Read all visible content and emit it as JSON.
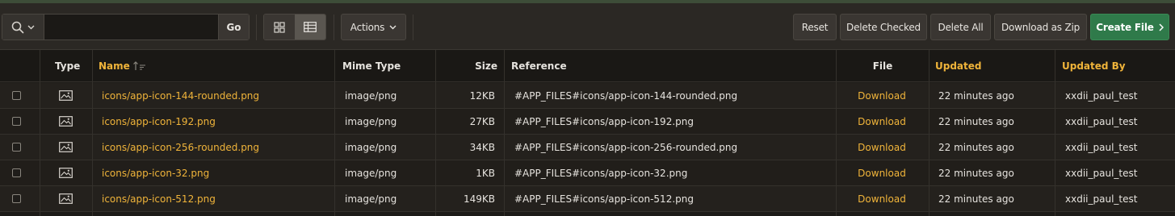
{
  "toolbar": {
    "search_placeholder": "",
    "search_value": "",
    "go_label": "Go",
    "actions_label": "Actions",
    "reset_label": "Reset",
    "delete_checked_label": "Delete Checked",
    "delete_all_label": "Delete All",
    "download_zip_label": "Download as Zip",
    "create_file_label": "Create File",
    "active_view": "report"
  },
  "table": {
    "columns": {
      "type": "Type",
      "name": "Name",
      "mime": "Mime Type",
      "size": "Size",
      "reference": "Reference",
      "file": "File",
      "updated": "Updated",
      "updated_by": "Updated By"
    },
    "sort": {
      "column": "name",
      "direction": "ascending"
    },
    "rows": [
      {
        "name": "icons/app-icon-144-rounded.png",
        "mime": "image/png",
        "size": "12KB",
        "reference": "#APP_FILES#icons/app-icon-144-rounded.png",
        "file": "Download",
        "updated": "22 minutes ago",
        "updated_by": "xxdii_paul_test",
        "type_icon": "image-icon",
        "checked": false
      },
      {
        "name": "icons/app-icon-192.png",
        "mime": "image/png",
        "size": "27KB",
        "reference": "#APP_FILES#icons/app-icon-192.png",
        "file": "Download",
        "updated": "22 minutes ago",
        "updated_by": "xxdii_paul_test",
        "type_icon": "image-icon",
        "checked": false
      },
      {
        "name": "icons/app-icon-256-rounded.png",
        "mime": "image/png",
        "size": "34KB",
        "reference": "#APP_FILES#icons/app-icon-256-rounded.png",
        "file": "Download",
        "updated": "22 minutes ago",
        "updated_by": "xxdii_paul_test",
        "type_icon": "image-icon",
        "checked": false
      },
      {
        "name": "icons/app-icon-32.png",
        "mime": "image/png",
        "size": "1KB",
        "reference": "#APP_FILES#icons/app-icon-32.png",
        "file": "Download",
        "updated": "22 minutes ago",
        "updated_by": "xxdii_paul_test",
        "type_icon": "image-icon",
        "checked": false
      },
      {
        "name": "icons/app-icon-512.png",
        "mime": "image/png",
        "size": "149KB",
        "reference": "#APP_FILES#icons/app-icon-512.png",
        "file": "Download",
        "updated": "22 minutes ago",
        "updated_by": "xxdii_paul_test",
        "type_icon": "image-icon",
        "checked": false
      }
    ]
  },
  "colors": {
    "accent_link": "#f0b43a",
    "create_button": "#2f7a4a",
    "background": "#1d1b18"
  }
}
